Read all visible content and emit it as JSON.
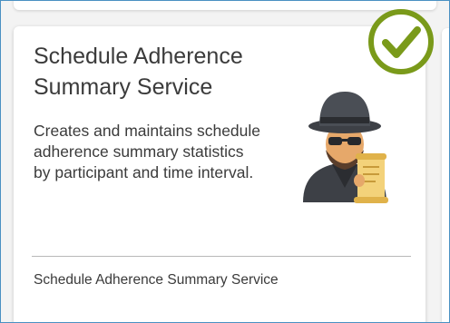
{
  "card": {
    "title": "Schedule Adherence Summary Service",
    "description": "Creates and maintains schedule adherence summary statistics by participant and time interval.",
    "footer": "Schedule Adherence Summary Service"
  },
  "icons": {
    "illustration": "spy-with-scroll-icon",
    "status": "check-circle-icon"
  },
  "colors": {
    "status_check": "#7a9a1a",
    "frame_border": "#4a90c2",
    "scroll": "#f3d27a"
  }
}
